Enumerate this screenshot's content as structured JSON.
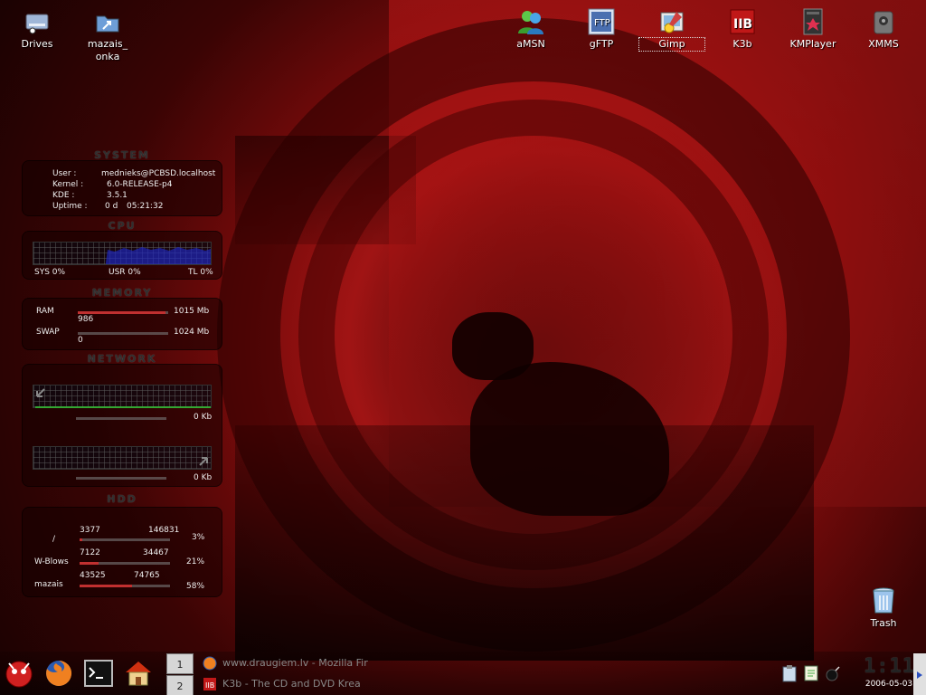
{
  "desktop_icons_left": [
    {
      "id": "drives",
      "label": "Drives"
    },
    {
      "id": "mazais",
      "label": "mazais_ onka"
    }
  ],
  "desktop_icons_top": [
    {
      "id": "amsn",
      "label": "aMSN"
    },
    {
      "id": "gftp",
      "label": "gFTP"
    },
    {
      "id": "gimp",
      "label": "Gimp"
    },
    {
      "id": "k3b",
      "label": "K3b"
    },
    {
      "id": "kmplayer",
      "label": "KMPlayer"
    },
    {
      "id": "xmms",
      "label": "XMMS"
    }
  ],
  "trash": {
    "label": "Trash"
  },
  "monitor": {
    "system_title": "SYSTEM",
    "user_label": "User :",
    "user_value": "mednieks@PCBSD.localhost",
    "kernel_label": "Kernel :",
    "kernel_value": "6.0-RELEASE-p4",
    "kde_label": "KDE :",
    "kde_value": "3.5.1",
    "uptime_label": "Uptime :",
    "uptime_days": "0 d",
    "uptime_time": "05:21:32",
    "cpu_title": "CPU",
    "sys": "SYS 0%",
    "usr": "USR 0%",
    "tl": "TL 0%",
    "memory_title": "MEMORY",
    "ram_label": "RAM",
    "ram_used": "986",
    "ram_total": "1015 Mb",
    "ram_fraction": 0.97,
    "swap_label": "SWAP",
    "swap_used": "0",
    "swap_total": "1024 Mb",
    "swap_fraction": 0.0,
    "network_title": "NETWORK",
    "net_in": "0 Kb",
    "net_out": "0 Kb",
    "hdd_title": "HDD",
    "disks": [
      {
        "name": "/",
        "used": "3377",
        "free": "146831",
        "pct": "3%",
        "fraction": 0.03
      },
      {
        "name": "W-Blows",
        "used": "7122",
        "free": "34467",
        "pct": "21%",
        "fraction": 0.21
      },
      {
        "name": "mazais",
        "used": "43525",
        "free": "74765",
        "pct": "58%",
        "fraction": 0.58
      }
    ]
  },
  "taskbar": {
    "desktops": [
      "1",
      "2"
    ],
    "tasks": [
      {
        "label": "www.draugiem.lv - Mozilla Fir"
      },
      {
        "label": "K3b - The CD and DVD Krea"
      }
    ],
    "clock": "1:11",
    "date": "2006-05-03"
  },
  "colors": {
    "accent": "#c01818",
    "panel": "#140000"
  }
}
